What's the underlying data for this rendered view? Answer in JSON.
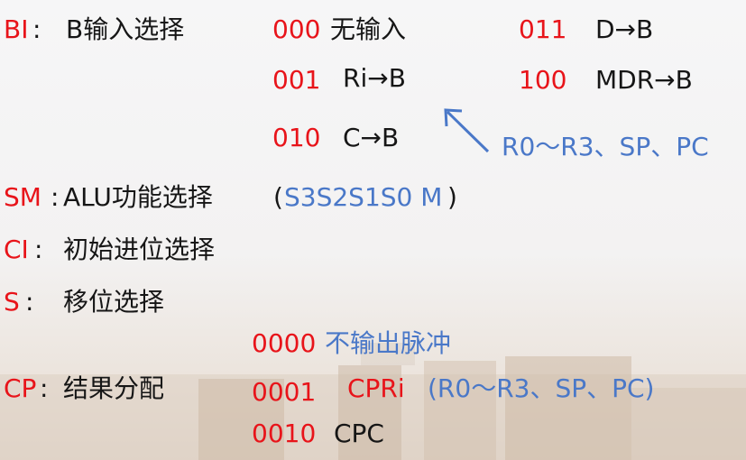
{
  "bi": {
    "label": "BI",
    "colon": ":",
    "desc": "B输入选择",
    "options": [
      {
        "code": "000",
        "text": "无输入"
      },
      {
        "code": "001",
        "text": "Ri→B"
      },
      {
        "code": "010",
        "text": "C→B"
      },
      {
        "code": "011",
        "text": "D→B"
      },
      {
        "code": "100",
        "text": "MDR→B"
      }
    ],
    "note": "R0～R3、SP、PC"
  },
  "sm": {
    "label": "SM",
    "colon": ":",
    "desc": "ALU功能选择",
    "paren_open": "(",
    "note": "S3S2S1S0 M",
    "paren_close": ")"
  },
  "ci": {
    "label": "CI",
    "colon": ":",
    "desc": "初始进位选择"
  },
  "s": {
    "label": "S",
    "colon": ":",
    "desc": "移位选择"
  },
  "cp": {
    "label": "CP",
    "colon": ":",
    "desc": "结果分配",
    "options": [
      {
        "code": "0000",
        "text": "不输出脉冲"
      },
      {
        "code": "0001",
        "text": "CPRi",
        "note": "(R0～R3、SP、PC)"
      },
      {
        "code": "0010",
        "text": "CPC"
      }
    ]
  },
  "colors": {
    "label": "#e8141a",
    "text": "#161616",
    "note": "#4a78c8"
  },
  "icons": {
    "arrow": "arrow-up-left-icon"
  }
}
